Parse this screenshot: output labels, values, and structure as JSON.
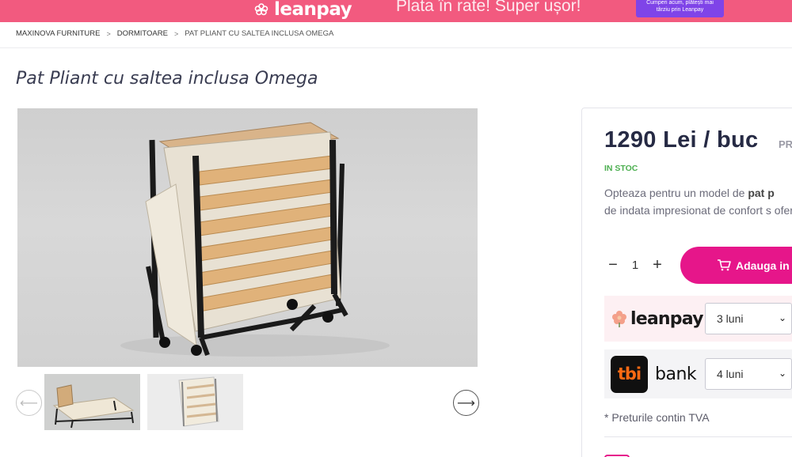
{
  "banner": {
    "logo_text": "leanpay",
    "promo_text": "Plata în rate! Super ușor!",
    "badge_line1": "Cumperi acum, plătești mai",
    "badge_line2": "târziu prin Leanpay",
    "color": "#f25a7f"
  },
  "breadcrumb": {
    "items": [
      "MAXINOVA FURNITURE",
      "DORMITOARE"
    ],
    "current": "PAT PLIANT CU SALTEA INCLUSA OMEGA",
    "separator": ">"
  },
  "product": {
    "title": "Pat Pliant cu saltea inclusa Omega",
    "price": "1290 Lei / buc",
    "code_label": "PR",
    "stock": "IN STOC",
    "desc_part1": "Opteaza pentru un model de ",
    "desc_bold": "pat p",
    "desc_part2": "de indata impresionat de confort s ofera.",
    "quantity": "1",
    "add_to_cart": "Adauga in"
  },
  "gallery": {
    "prev_icon": "arrow-left-icon",
    "next_icon": "arrow-right-icon",
    "thumbnail_count": 2
  },
  "financing": {
    "leanpay": {
      "logo": "leanpay",
      "selected": "3 luni"
    },
    "tbi": {
      "logo_mark": "tbi",
      "logo_text": "bank",
      "selected": "4 luni"
    }
  },
  "vat_note": "* Preturile contin TVA",
  "colors": {
    "accent": "#e6168a",
    "stock": "#4caf50",
    "price": "#262a44"
  }
}
